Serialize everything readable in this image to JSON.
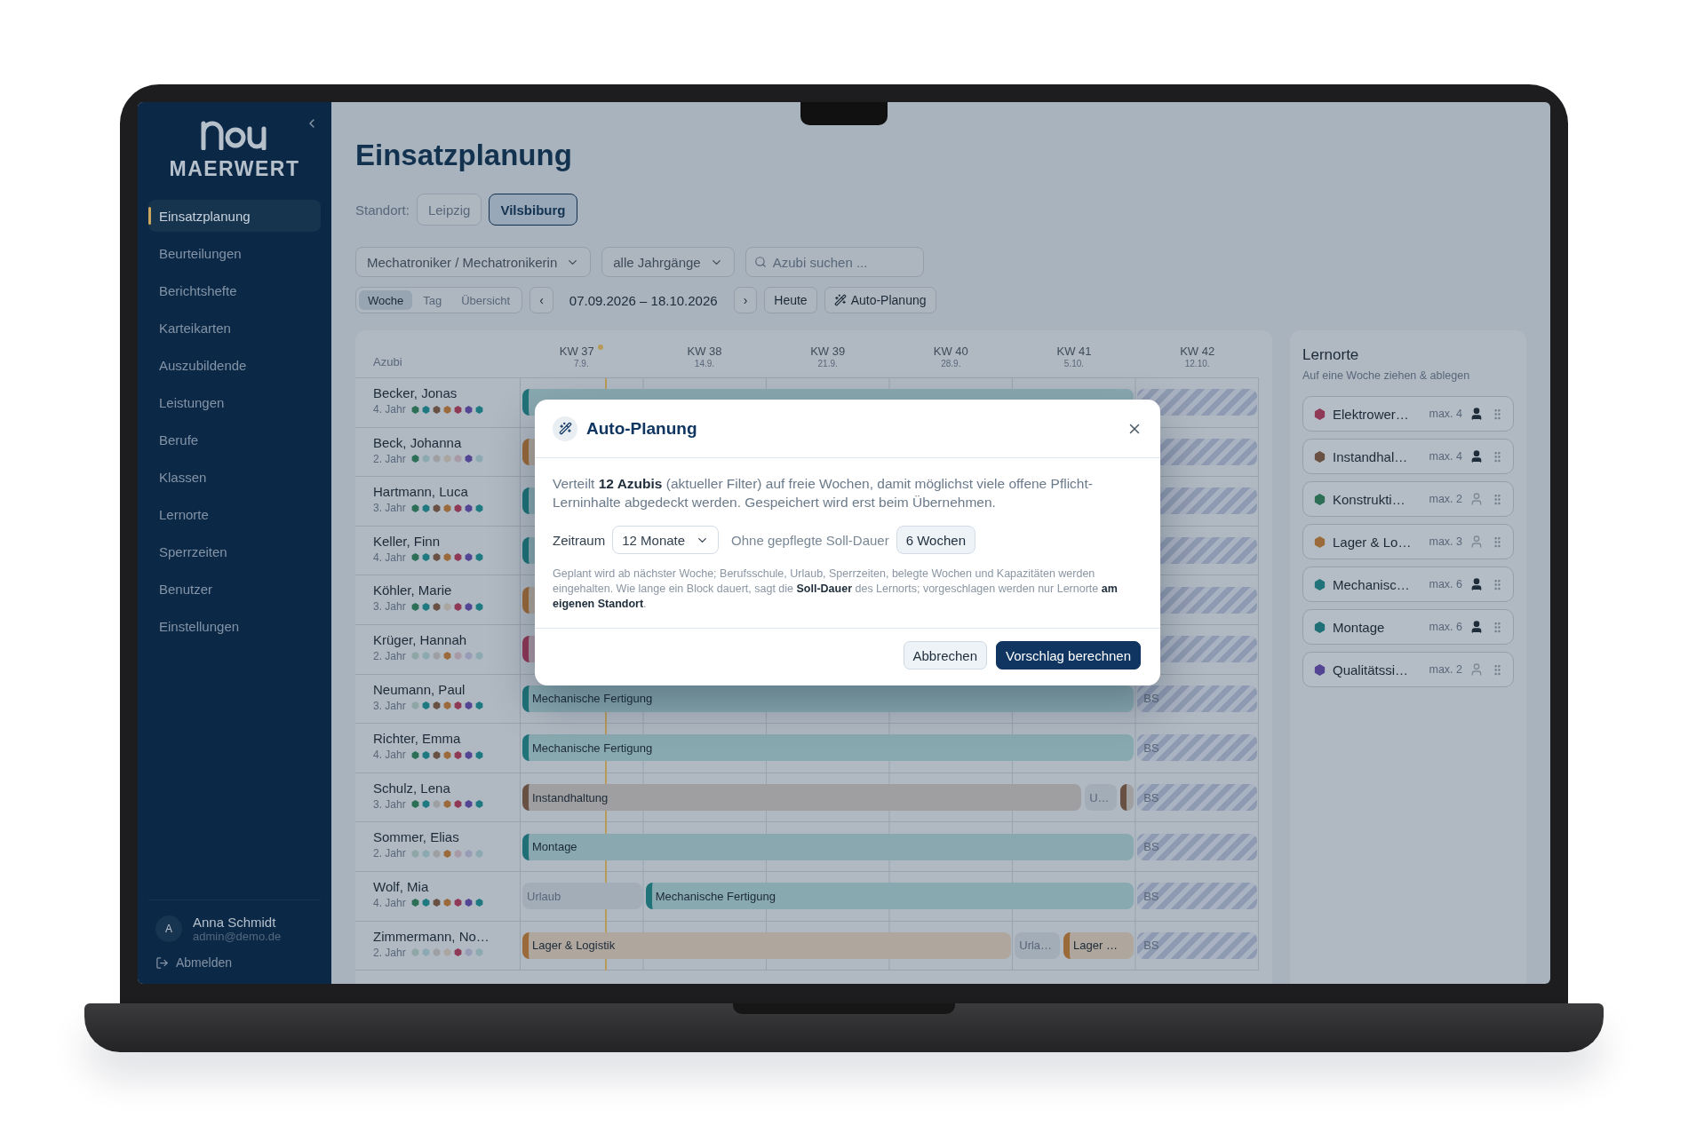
{
  "sidebar": {
    "brand": "MAERWERT",
    "items": [
      {
        "label": "Einsatzplanung",
        "selected": true
      },
      {
        "label": "Beurteilungen",
        "selected": false
      },
      {
        "label": "Berichtshefte",
        "selected": false
      },
      {
        "label": "Karteikarten",
        "selected": false
      },
      {
        "label": "Auszubildende",
        "selected": false
      },
      {
        "label": "Leistungen",
        "selected": false
      },
      {
        "label": "Berufe",
        "selected": false
      },
      {
        "label": "Klassen",
        "selected": false
      },
      {
        "label": "Lernorte",
        "selected": false
      },
      {
        "label": "Sperrzeiten",
        "selected": false
      },
      {
        "label": "Benutzer",
        "selected": false
      },
      {
        "label": "Einstellungen",
        "selected": false
      }
    ],
    "user": {
      "initial": "A",
      "name": "Anna Schmidt",
      "email": "admin@demo.de"
    },
    "logout": "Abmelden"
  },
  "page": {
    "title": "Einsatzplanung"
  },
  "location": {
    "label": "Standort:",
    "options": [
      {
        "label": "Leipzig",
        "selected": false
      },
      {
        "label": "Vilsbiburg",
        "selected": true
      }
    ]
  },
  "filters": {
    "profession": "Mechatroniker / Mechatronikerin",
    "year": "alle Jahrgänge",
    "search": {
      "placeholder": "Azubi suchen ..."
    }
  },
  "toolbar": {
    "views": [
      {
        "label": "Woche",
        "selected": true
      },
      {
        "label": "Tag",
        "selected": false
      },
      {
        "label": "Übersicht",
        "selected": false
      }
    ],
    "prev": "‹",
    "range": "07.09.2026 – 18.10.2026",
    "next": "›",
    "today": "Heute",
    "auto": "Auto-Planung"
  },
  "planner": {
    "name_heading": "Azubi",
    "weeks": [
      {
        "label": "KW 37",
        "date": "7.9.",
        "current": true
      },
      {
        "label": "KW 38",
        "date": "14.9.",
        "current": false
      },
      {
        "label": "KW 39",
        "date": "21.9.",
        "current": false
      },
      {
        "label": "KW 40",
        "date": "28.9.",
        "current": false
      },
      {
        "label": "KW 41",
        "date": "5.10.",
        "current": false
      },
      {
        "label": "KW 42",
        "date": "12.10.",
        "current": false
      }
    ],
    "rows": [
      {
        "name": "Becker, Jonas",
        "year": "4. Jahr",
        "dots": [
          {
            "color": "#2c6f56"
          },
          {
            "color": "#1f7980"
          },
          {
            "color": "#685042"
          },
          {
            "color": "#9b6a3a"
          },
          {
            "color": "#903957"
          },
          {
            "color": "#534594"
          },
          {
            "color": "#1f7980"
          }
        ],
        "segments": [
          {
            "kind": "placement",
            "color": "#1f7379"
          },
          {
            "kind": "school"
          }
        ]
      },
      {
        "name": "Beck, Johanna",
        "year": "2. Jahr",
        "dots": [
          {
            "color": "#2c6f56"
          },
          {
            "color": "#8ca9b2"
          },
          {
            "color": "#9e9fa2"
          },
          {
            "color": "#aba5a0"
          },
          {
            "color": "#a899a7"
          },
          {
            "color": "#534594"
          },
          {
            "color": "#8ca9b2"
          }
        ],
        "segments": [
          {
            "kind": "placement",
            "color": "#9b6a3a"
          },
          {
            "kind": "school"
          }
        ]
      },
      {
        "name": "Hartmann, Luca",
        "year": "3. Jahr",
        "dots": [
          {
            "color": "#2c6f56"
          },
          {
            "color": "#1f7980"
          },
          {
            "color": "#685042"
          },
          {
            "color": "#9b6a3a"
          },
          {
            "color": "#903957"
          },
          {
            "color": "#534594"
          },
          {
            "color": "#1f7980"
          }
        ],
        "segments": [
          {
            "kind": "placement",
            "color": "#1f7379"
          },
          {
            "kind": "school"
          }
        ]
      },
      {
        "name": "Keller, Finn",
        "year": "4. Jahr",
        "dots": [
          {
            "color": "#2c6f56"
          },
          {
            "color": "#1f7980"
          },
          {
            "color": "#685042"
          },
          {
            "color": "#9b6a3a"
          },
          {
            "color": "#903957"
          },
          {
            "color": "#534594"
          },
          {
            "color": "#1f7980"
          }
        ],
        "segments": [
          {
            "kind": "placement",
            "color": "#1f7379"
          },
          {
            "kind": "school"
          }
        ]
      },
      {
        "name": "Köhler, Marie",
        "year": "3. Jahr",
        "dots": [
          {
            "color": "#2c6f56"
          },
          {
            "color": "#1f7980"
          },
          {
            "color": "#685042"
          },
          {
            "color": "#aba5a0"
          },
          {
            "color": "#903957"
          },
          {
            "color": "#534594"
          },
          {
            "color": "#1f7980"
          }
        ],
        "segments": [
          {
            "kind": "placement",
            "color": "#9b6a3a"
          },
          {
            "kind": "school"
          }
        ]
      },
      {
        "name": "Krüger, Hannah",
        "year": "2. Jahr",
        "dots": [
          {
            "color": "#8fa6a7"
          },
          {
            "color": "#8ca9b2"
          },
          {
            "color": "#9e9fa2"
          },
          {
            "color": "#9b6a3a"
          },
          {
            "color": "#a899a7"
          },
          {
            "color": "#999cb6"
          },
          {
            "color": "#8ca9b2"
          }
        ],
        "segments": [
          {
            "kind": "placement",
            "color": "#903957"
          },
          {
            "kind": "school"
          }
        ]
      },
      {
        "name": "Neumann, Paul",
        "year": "3. Jahr",
        "dots": [
          {
            "color": "#8fa6a7"
          },
          {
            "color": "#1f7980"
          },
          {
            "color": "#685042"
          },
          {
            "color": "#9b6a3a"
          },
          {
            "color": "#903957"
          },
          {
            "color": "#534594"
          },
          {
            "color": "#1f7980"
          }
        ],
        "segments": [
          {
            "kind": "placement",
            "label": "Mechanische Fertigung",
            "color": "#1f7379"
          },
          {
            "kind": "school",
            "label": "BS"
          }
        ]
      },
      {
        "name": "Richter, Emma",
        "year": "4. Jahr",
        "dots": [
          {
            "color": "#2c6f56"
          },
          {
            "color": "#1f7980"
          },
          {
            "color": "#685042"
          },
          {
            "color": "#9b6a3a"
          },
          {
            "color": "#903957"
          },
          {
            "color": "#534594"
          },
          {
            "color": "#1f7980"
          }
        ],
        "segments": [
          {
            "kind": "placement",
            "label": "Mechanische Fertigung",
            "color": "#1f7379"
          },
          {
            "kind": "school",
            "label": "BS"
          }
        ]
      },
      {
        "name": "Schulz, Lena",
        "year": "3. Jahr",
        "dots": [
          {
            "color": "#2c6f56"
          },
          {
            "color": "#1f7980"
          },
          {
            "color": "#9e9fa2"
          },
          {
            "color": "#9b6a3a"
          },
          {
            "color": "#903957"
          },
          {
            "color": "#534594"
          },
          {
            "color": "#1f7980"
          }
        ],
        "segments": [
          {
            "kind": "placement",
            "label": "Instandhaltung",
            "color": "#685042"
          },
          {
            "kind": "vacation",
            "label": "U…"
          },
          {
            "kind": "placement",
            "color": "#685042"
          },
          {
            "kind": "school",
            "label": "BS"
          }
        ]
      },
      {
        "name": "Sommer, Elias",
        "year": "2. Jahr",
        "dots": [
          {
            "color": "#8fa6a7"
          },
          {
            "color": "#8ca9b2"
          },
          {
            "color": "#9e9fa2"
          },
          {
            "color": "#9b6a3a"
          },
          {
            "color": "#a899a7"
          },
          {
            "color": "#999cb6"
          },
          {
            "color": "#8ca9b2"
          }
        ],
        "segments": [
          {
            "kind": "placement",
            "label": "Montage",
            "color": "#1f6f76"
          },
          {
            "kind": "school",
            "label": "BS"
          }
        ]
      },
      {
        "name": "Wolf, Mia",
        "year": "4. Jahr",
        "dots": [
          {
            "color": "#2c6f56"
          },
          {
            "color": "#1f7980"
          },
          {
            "color": "#685042"
          },
          {
            "color": "#9b6a3a"
          },
          {
            "color": "#903957"
          },
          {
            "color": "#534594"
          },
          {
            "color": "#1f7980"
          }
        ],
        "segments": [
          {
            "kind": "vacation",
            "label": "Urlaub"
          },
          {
            "kind": "placement",
            "label": "Mechanische Fertigung",
            "color": "#1f7379"
          },
          {
            "kind": "school",
            "label": "BS"
          }
        ]
      },
      {
        "name": "Zimmermann, No…",
        "year": "2. Jahr",
        "dots": [
          {
            "color": "#8fa6a7"
          },
          {
            "color": "#8ca9b2"
          },
          {
            "color": "#9e9fa2"
          },
          {
            "color": "#aba5a0"
          },
          {
            "color": "#903957"
          },
          {
            "color": "#999cb6"
          },
          {
            "color": "#8ca9b2"
          }
        ],
        "segments": [
          {
            "kind": "placement",
            "label": "Lager & Logistik",
            "color": "#9b6a3a"
          },
          {
            "kind": "vacation",
            "label": "Urla…"
          },
          {
            "kind": "placement",
            "label": "Lager …",
            "color": "#9b6a3a"
          },
          {
            "kind": "school",
            "label": "BS"
          }
        ]
      }
    ]
  },
  "locations_panel": {
    "title": "Lernorte",
    "subtitle": "Auf eine Woche ziehen & ablegen",
    "items": [
      {
        "name": "Elektrower…",
        "max": "max. 4",
        "color": "#903957",
        "occupied": true
      },
      {
        "name": "Instandhal…",
        "max": "max. 4",
        "color": "#685042",
        "occupied": true
      },
      {
        "name": "Konstrukti…",
        "max": "max. 2",
        "color": "#2c6f56",
        "occupied": false
      },
      {
        "name": "Lager & Lo…",
        "max": "max. 3",
        "color": "#9b6a3a",
        "occupied": false
      },
      {
        "name": "Mechanisc…",
        "max": "max. 6",
        "color": "#1f7379",
        "occupied": true
      },
      {
        "name": "Montage",
        "max": "max. 6",
        "color": "#1f6f76",
        "occupied": true
      },
      {
        "name": "Qualitätssi…",
        "max": "max. 2",
        "color": "#534594",
        "occupied": false
      }
    ]
  },
  "dialog": {
    "title": "Auto-Planung",
    "intro": "Verteilt **12 Azubis** (aktueller Filter) auf freie Wochen, damit möglichst viele offene Pflicht-Lerninhalte abgedeckt werden. Gespeichert wird erst beim Übernehmen.",
    "period_label": "Zeitraum",
    "period_value": "12 Monate",
    "default_label": "Ohne gepflegte Soll-Dauer",
    "default_value": "6 Wochen",
    "note": "Geplant wird ab nächster Woche; Berufsschule, Urlaub, Sperrzeiten, belegte Wochen und Kapazitäten werden eingehalten. Wie lange ein Block dauert, sagt die **Soll-Dauer** des Lernorts; vorgeschlagen werden nur Lernorte **am eigenen Standort**.",
    "buttons": [
      {
        "label": "Abbrechen",
        "kind": "secondary"
      },
      {
        "label": "Vorschlag berechnen",
        "kind": "primary"
      }
    ]
  }
}
